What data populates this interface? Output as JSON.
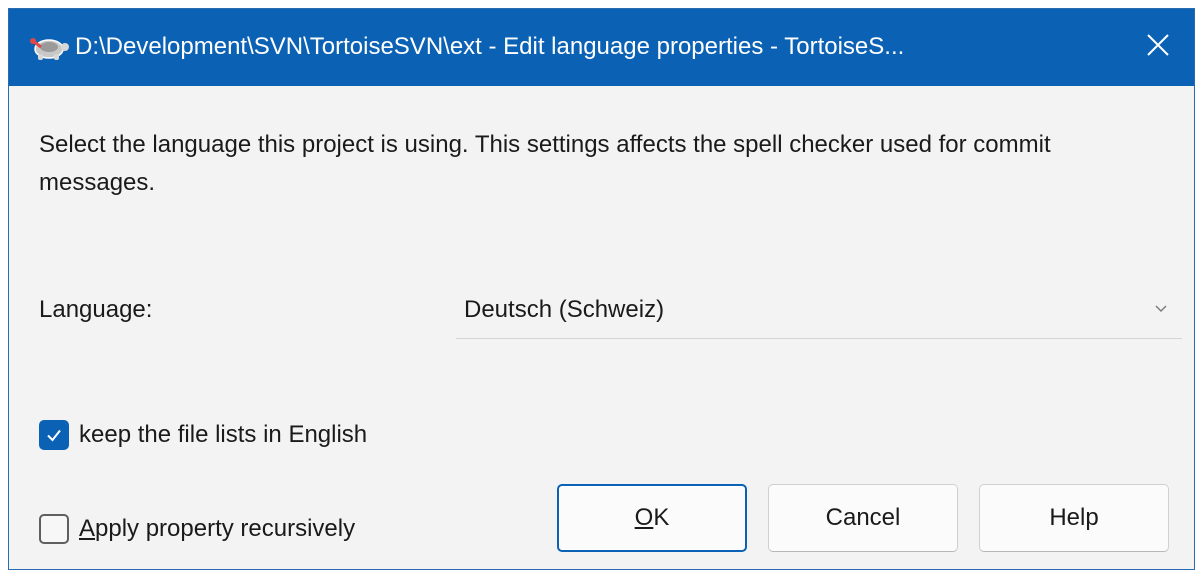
{
  "window": {
    "title": "D:\\Development\\SVN\\TortoiseSVN\\ext - Edit language properties - TortoiseS...",
    "icon": "tortoise-icon",
    "close_icon": "close-icon"
  },
  "dialog": {
    "description": "Select the language this project is using. This settings affects the spell checker used for commit messages.",
    "language_label": "Language:",
    "language_value": "Deutsch (Schweiz)",
    "keep_english_label": "keep the file lists in English",
    "keep_english_checked": true,
    "recursive_label_accesskey": "A",
    "recursive_label_rest": "pply property recursively",
    "recursive_checked": false
  },
  "buttons": {
    "ok_accesskey": "O",
    "ok_rest": "K",
    "cancel": "Cancel",
    "help": "Help"
  },
  "colors": {
    "accent": "#0b62b4",
    "background": "#f3f3f3"
  }
}
